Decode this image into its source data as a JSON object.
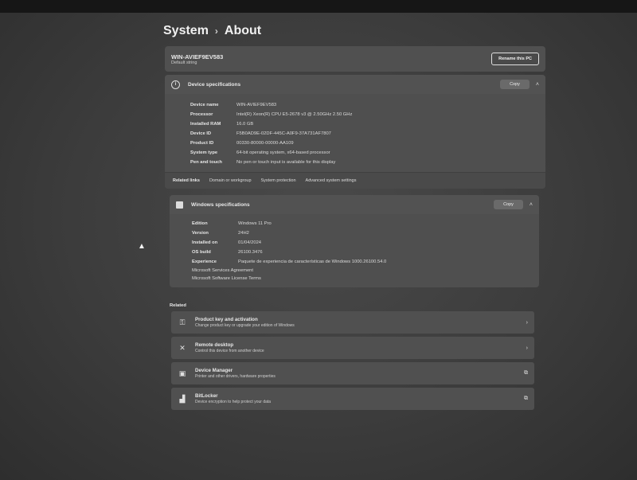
{
  "breadcrumb": {
    "parent": "System",
    "separator": "›",
    "current": "About"
  },
  "pc": {
    "name": "WIN-AVIEF9EV583",
    "subtitle": "Default string",
    "rename_label": "Rename this PC"
  },
  "device_specs": {
    "title": "Device specifications",
    "copy_label": "Copy",
    "rows": [
      {
        "k": "Device name",
        "v": "WIN-AVIEF9EV583"
      },
      {
        "k": "Processor",
        "v": "Intel(R) Xeon(R) CPU E5-2678 v3 @ 2.50GHz   2.50 GHz"
      },
      {
        "k": "Installed RAM",
        "v": "16.0 GB"
      },
      {
        "k": "Device ID",
        "v": "F5B0AD9E-02DF-445C-A0F9-37A731AF7807"
      },
      {
        "k": "Product ID",
        "v": "00330-80000-00000-AA109"
      },
      {
        "k": "System type",
        "v": "64-bit operating system, x64-based processor"
      },
      {
        "k": "Pen and touch",
        "v": "No pen or touch input is available for this display"
      }
    ]
  },
  "related_links": {
    "label": "Related links",
    "items": [
      "Domain or workgroup",
      "System protection",
      "Advanced system settings"
    ]
  },
  "windows_specs": {
    "title": "Windows specifications",
    "copy_label": "Copy",
    "rows": [
      {
        "k": "Edition",
        "v": "Windows 11 Pro"
      },
      {
        "k": "Version",
        "v": "24H2"
      },
      {
        "k": "Installed on",
        "v": "01/04/2024"
      },
      {
        "k": "OS build",
        "v": "26100.3476"
      },
      {
        "k": "Experience",
        "v": "Paquete de experiencia de características de Windows 1000.26100.54.0"
      }
    ],
    "links": [
      "Microsoft Services Agreement",
      "Microsoft Software License Terms"
    ]
  },
  "related": {
    "label": "Related",
    "items": [
      {
        "title": "Product key and activation",
        "desc": "Change product key or upgrade your edition of Windows",
        "icon": "key-icon",
        "trail": "chevron-right-icon"
      },
      {
        "title": "Remote desktop",
        "desc": "Control this device from another device",
        "icon": "remote-icon",
        "trail": "chevron-right-icon"
      },
      {
        "title": "Device Manager",
        "desc": "Printer and other drivers, hardware properties",
        "icon": "device-manager-icon",
        "trail": "open-external-icon"
      },
      {
        "title": "BitLocker",
        "desc": "Device encryption to help protect your data",
        "icon": "bitlocker-icon",
        "trail": "open-external-icon"
      }
    ]
  },
  "icons": {
    "separator": "›",
    "chevron_up": "˄",
    "chevron_right": "›",
    "external": "⧉",
    "info": "i",
    "key": "⚿",
    "remote": "✕",
    "device_manager": "▣",
    "bitlocker": "▟",
    "cursor": "▲"
  }
}
